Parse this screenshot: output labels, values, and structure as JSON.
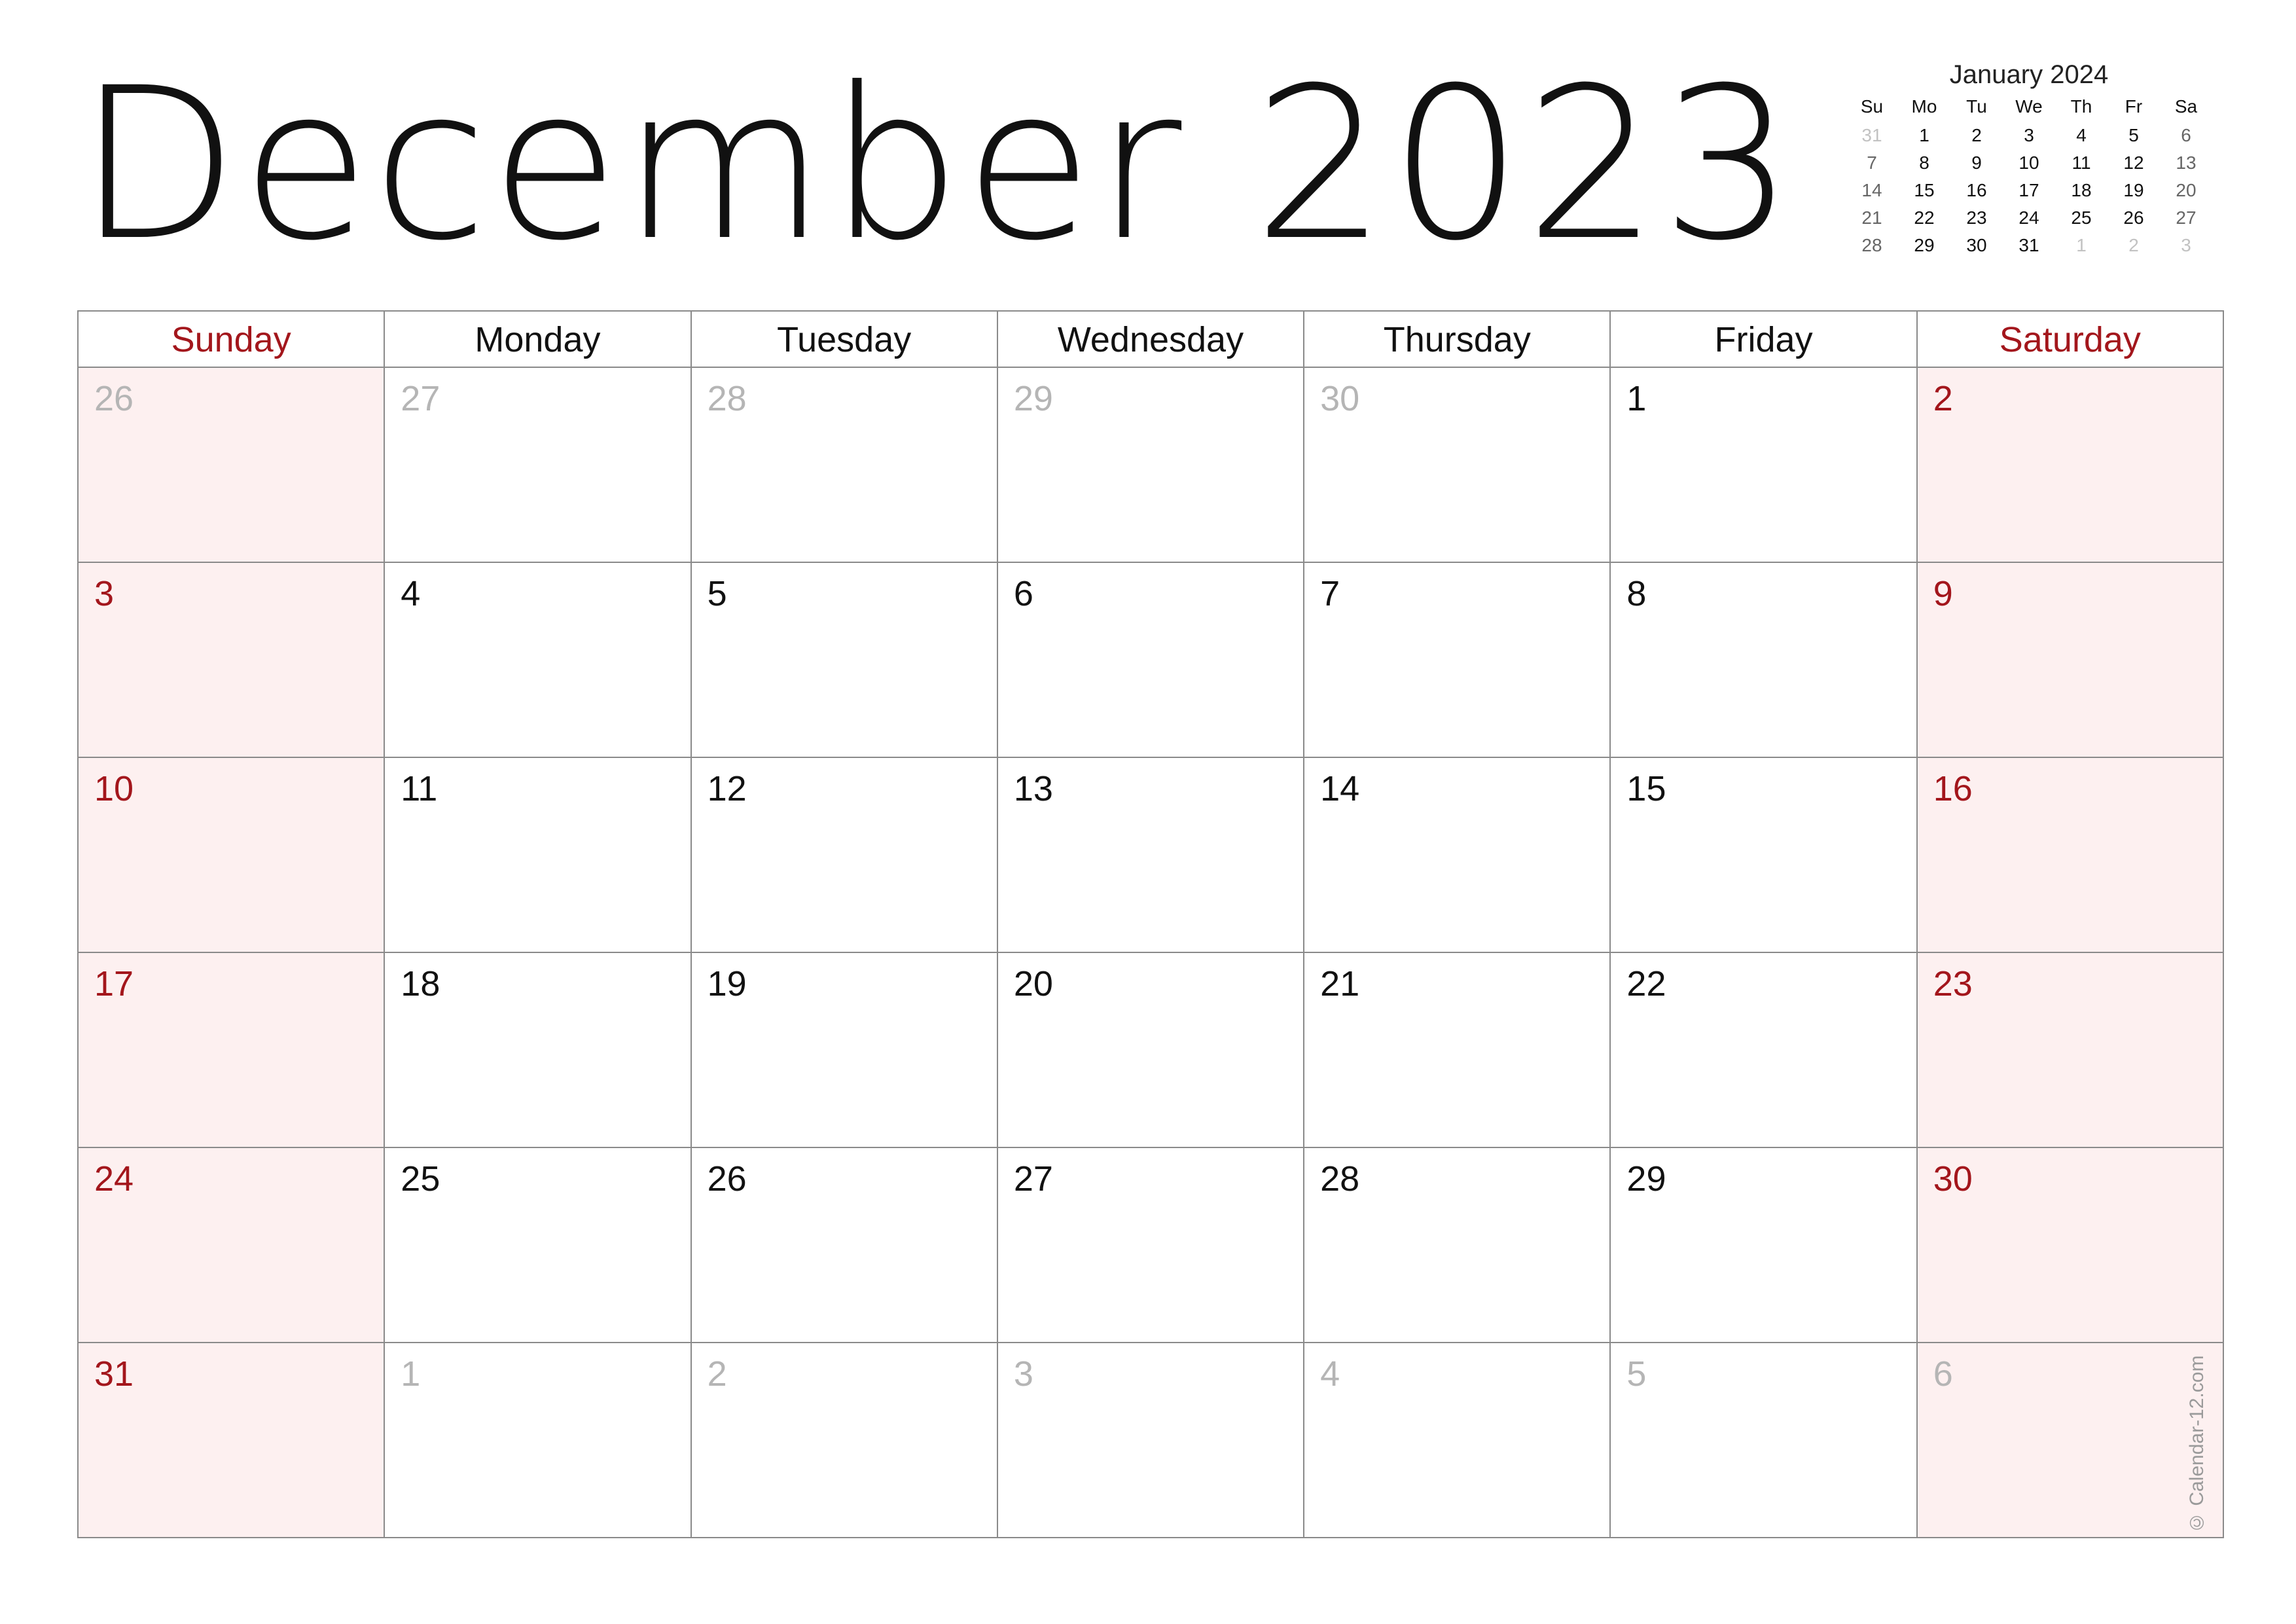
{
  "title": "December 2023",
  "colors": {
    "weekend_text": "#a3161c",
    "weekend_fill": "#fdf0f0",
    "muted_text": "#b5b5b5",
    "grid_line": "#8a8a8a"
  },
  "mini_calendar": {
    "title": "January 2024",
    "weekdays": [
      "Su",
      "Mo",
      "Tu",
      "We",
      "Th",
      "Fr",
      "Sa"
    ],
    "weeks": [
      [
        "31",
        "1",
        "2",
        "3",
        "4",
        "5",
        "6"
      ],
      [
        "7",
        "8",
        "9",
        "10",
        "11",
        "12",
        "13"
      ],
      [
        "14",
        "15",
        "16",
        "17",
        "18",
        "19",
        "20"
      ],
      [
        "21",
        "22",
        "23",
        "24",
        "25",
        "26",
        "27"
      ],
      [
        "28",
        "29",
        "30",
        "31",
        "1",
        "2",
        "3"
      ]
    ],
    "muted": [
      [
        0,
        0
      ],
      [
        4,
        4
      ],
      [
        4,
        5
      ],
      [
        4,
        6
      ]
    ]
  },
  "calendar": {
    "weekdays": [
      "Sunday",
      "Monday",
      "Tuesday",
      "Wednesday",
      "Thursday",
      "Friday",
      "Saturday"
    ],
    "weeks": [
      [
        "26",
        "27",
        "28",
        "29",
        "30",
        "1",
        "2"
      ],
      [
        "3",
        "4",
        "5",
        "6",
        "7",
        "8",
        "9"
      ],
      [
        "10",
        "11",
        "12",
        "13",
        "14",
        "15",
        "16"
      ],
      [
        "17",
        "18",
        "19",
        "20",
        "21",
        "22",
        "23"
      ],
      [
        "24",
        "25",
        "26",
        "27",
        "28",
        "29",
        "30"
      ],
      [
        "31",
        "1",
        "2",
        "3",
        "4",
        "5",
        "6"
      ]
    ],
    "other_month": [
      [
        0,
        0
      ],
      [
        0,
        1
      ],
      [
        0,
        2
      ],
      [
        0,
        3
      ],
      [
        0,
        4
      ],
      [
        5,
        1
      ],
      [
        5,
        2
      ],
      [
        5,
        3
      ],
      [
        5,
        4
      ],
      [
        5,
        5
      ],
      [
        5,
        6
      ]
    ]
  },
  "watermark": "© Calendar-12.com"
}
